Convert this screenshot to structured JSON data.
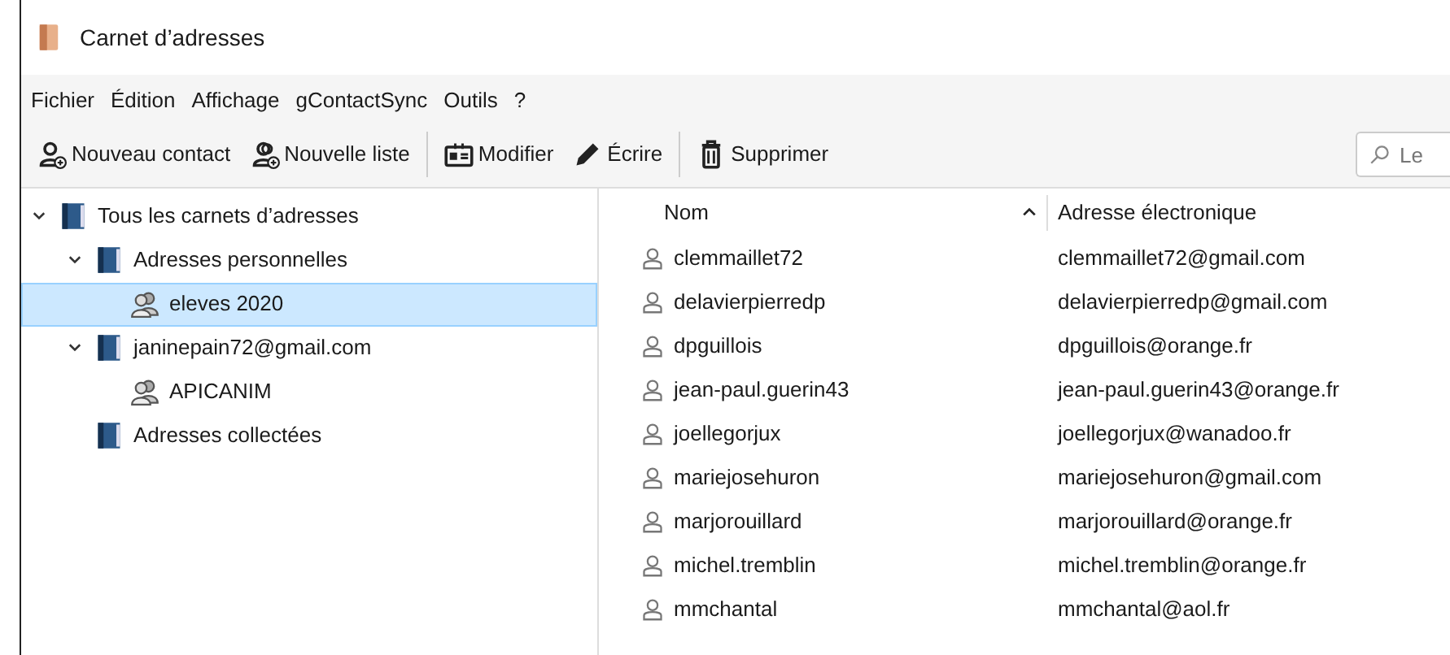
{
  "window": {
    "title": "Carnet d’adresses"
  },
  "menu": [
    "Fichier",
    "Édition",
    "Affichage",
    "gContactSync",
    "Outils",
    "?"
  ],
  "toolbar": [
    {
      "kind": "new-contact",
      "label": "Nouveau contact"
    },
    {
      "kind": "new-list",
      "label": "Nouvelle liste"
    },
    {
      "kind": "separator"
    },
    {
      "kind": "edit",
      "label": "Modifier"
    },
    {
      "kind": "write",
      "label": "Écrire"
    },
    {
      "kind": "separator"
    },
    {
      "kind": "delete",
      "label": "Supprimer"
    }
  ],
  "search": {
    "placeholder": "Le"
  },
  "tree": [
    {
      "kind": "book",
      "label": "Tous les carnets d’adresses",
      "expanded": true,
      "selected": false,
      "children": [
        {
          "kind": "book",
          "label": "Adresses personnelles",
          "expanded": true,
          "selected": false,
          "children": [
            {
              "kind": "list",
              "label": "eleves 2020",
              "selected": true
            }
          ]
        },
        {
          "kind": "book",
          "label": "janinepain72@gmail.com",
          "expanded": true,
          "selected": false,
          "children": [
            {
              "kind": "list",
              "label": "APICANIM",
              "selected": false
            }
          ]
        },
        {
          "kind": "book",
          "label": "Adresses collectées",
          "selected": false
        }
      ]
    }
  ],
  "table": {
    "columns": [
      {
        "label": "Nom",
        "sorted": true
      },
      {
        "label": "Adresse électronique",
        "sorted": false
      }
    ],
    "rows": [
      [
        "clemmaillet72",
        "clemmaillet72@gmail.com"
      ],
      [
        "delavierpierredp",
        "delavierpierredp@gmail.com"
      ],
      [
        "dpguillois",
        "dpguillois@orange.fr"
      ],
      [
        "jean-paul.guerin43",
        "jean-paul.guerin43@orange.fr"
      ],
      [
        "joellegorjux",
        "joellegorjux@wanadoo.fr"
      ],
      [
        "mariejosehuron",
        "mariejosehuron@gmail.com"
      ],
      [
        "marjorouillard",
        "marjorouillard@orange.fr"
      ],
      [
        "michel.tremblin",
        "michel.tremblin@orange.fr"
      ],
      [
        "mmchantal",
        "mmchantal@aol.fr"
      ]
    ]
  }
}
